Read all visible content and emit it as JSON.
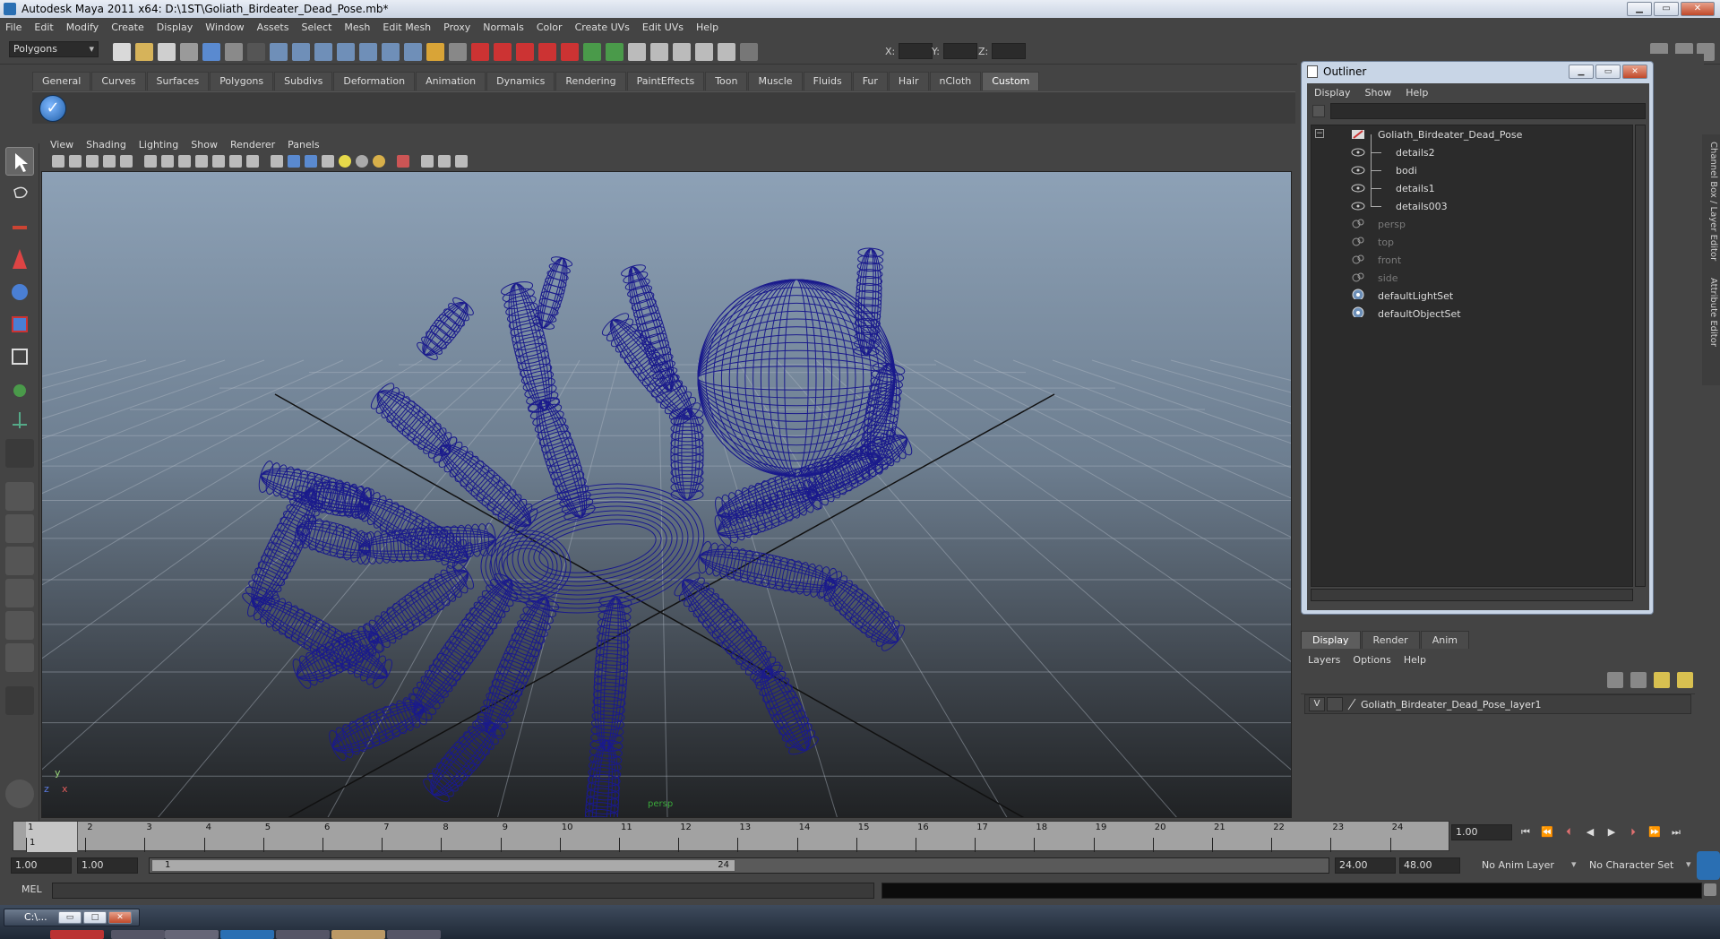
{
  "window": {
    "title": "Autodesk Maya 2011 x64: D:\\1ST\\Goliath_Birdeater_Dead_Pose.mb*"
  },
  "menubar": [
    "File",
    "Edit",
    "Modify",
    "Create",
    "Display",
    "Window",
    "Assets",
    "Select",
    "Mesh",
    "Edit Mesh",
    "Proxy",
    "Normals",
    "Color",
    "Create UVs",
    "Edit UVs",
    "Help"
  ],
  "statusline": {
    "mode": "Polygons",
    "x_label": "X:",
    "y_label": "Y:",
    "z_label": "Z:"
  },
  "shelf": {
    "tabs": [
      "General",
      "Curves",
      "Surfaces",
      "Polygons",
      "Subdivs",
      "Deformation",
      "Animation",
      "Dynamics",
      "Rendering",
      "PaintEffects",
      "Toon",
      "Muscle",
      "Fluids",
      "Fur",
      "Hair",
      "nCloth",
      "Custom"
    ],
    "active_tab": "Custom"
  },
  "viewport": {
    "menu": [
      "View",
      "Shading",
      "Lighting",
      "Show",
      "Renderer",
      "Panels"
    ],
    "camera_label": "persp",
    "axis_y": "y",
    "axis_x": "x",
    "axis_z": "z",
    "wire_color": "#1a1a8c"
  },
  "outliner": {
    "title": "Outliner",
    "menu": [
      "Display",
      "Show",
      "Help"
    ],
    "items": [
      {
        "label": "Goliath_Birdeater_Dead_Pose",
        "type": "group"
      },
      {
        "label": "details2",
        "type": "mesh"
      },
      {
        "label": "bodi",
        "type": "mesh"
      },
      {
        "label": "details1",
        "type": "mesh"
      },
      {
        "label": "details003",
        "type": "mesh"
      },
      {
        "label": "persp",
        "type": "camera"
      },
      {
        "label": "top",
        "type": "camera"
      },
      {
        "label": "front",
        "type": "camera"
      },
      {
        "label": "side",
        "type": "camera"
      },
      {
        "label": "defaultLightSet",
        "type": "set"
      },
      {
        "label": "defaultObjectSet",
        "type": "set"
      }
    ]
  },
  "channel_tabs": [
    "Channel Box / Layer Editor",
    "Attribute Editor"
  ],
  "layer_editor": {
    "tabs": [
      "Display",
      "Render",
      "Anim"
    ],
    "menu": [
      "Layers",
      "Options",
      "Help"
    ],
    "layers": [
      {
        "visible": "V",
        "name": "Goliath_Birdeater_Dead_Pose_layer1"
      }
    ]
  },
  "timeline": {
    "start": 1,
    "end": 24,
    "current_frame": "1.00",
    "current_marker": "1",
    "ticks": [
      "1",
      "2",
      "3",
      "4",
      "5",
      "6",
      "7",
      "8",
      "9",
      "10",
      "11",
      "12",
      "13",
      "14",
      "15",
      "16",
      "17",
      "18",
      "19",
      "20",
      "21",
      "22",
      "23",
      "24"
    ]
  },
  "range": {
    "start_time": "1.00",
    "playback_start": "1.00",
    "range_start": "1",
    "range_end": "24",
    "playback_end": "24.00",
    "end_time": "48.00",
    "anim_layer": "No Anim Layer",
    "character_set": "No Character Set"
  },
  "cmdline": {
    "label": "MEL"
  },
  "taskbar": {
    "task_label": "C:\\..."
  }
}
